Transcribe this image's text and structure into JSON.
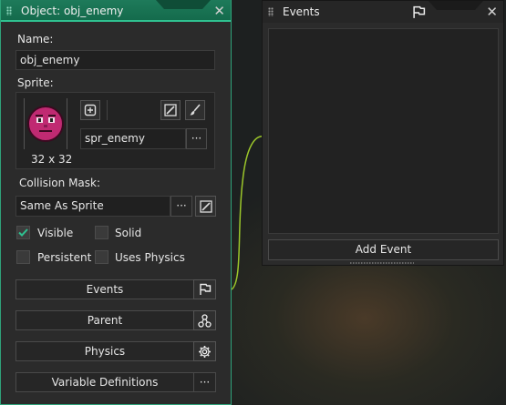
{
  "object_panel": {
    "title": "Object: obj_enemy",
    "name_label": "Name:",
    "name_value": "obj_enemy",
    "sprite_label": "Sprite:",
    "sprite_name": "spr_enemy",
    "sprite_size": "32 x 32",
    "collision_label": "Collision Mask:",
    "collision_value": "Same As Sprite",
    "ellipsis": "···",
    "checkboxes": [
      {
        "label": "Visible",
        "checked": true
      },
      {
        "label": "Solid",
        "checked": false
      },
      {
        "label": "Persistent",
        "checked": false
      },
      {
        "label": "Uses Physics",
        "checked": false
      }
    ],
    "buttons": {
      "events": "Events",
      "parent": "Parent",
      "physics": "Physics",
      "variable_definitions": "Variable Definitions"
    }
  },
  "events_panel": {
    "title": "Events",
    "add_event": "Add Event"
  },
  "colors": {
    "accent": "#2fc190",
    "sprite_face": "#c02a72",
    "curve": "#9bc62a"
  }
}
